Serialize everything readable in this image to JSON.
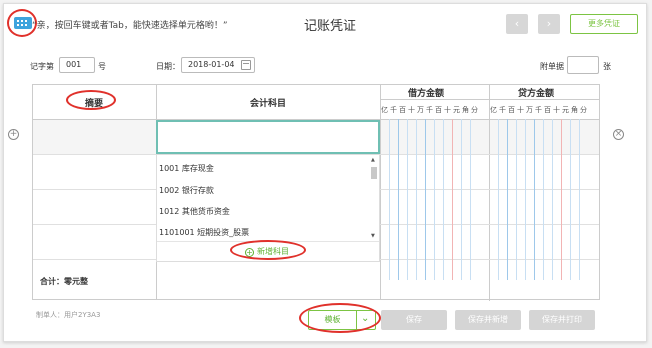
{
  "header": {
    "tip": "“亲，按回车键或者Tab，能快速选择单元格哟！”",
    "title": "记账凭证",
    "prev_glyph": "‹",
    "next_glyph": "›",
    "more_label": "更多凭证"
  },
  "meta": {
    "voucher_word_label": "记字第",
    "voucher_no": "001",
    "voucher_suffix": "号",
    "date_label": "日期：",
    "date": "2018-01-04",
    "attach_label": "附单据",
    "attach_value": "",
    "attach_unit": "张"
  },
  "table": {
    "col_summary": "摘要",
    "col_account": "会计科目",
    "col_debit": "借方金额",
    "col_credit": "贷方金额",
    "digits": [
      "亿",
      "千",
      "百",
      "十",
      "万",
      "千",
      "百",
      "十",
      "元",
      "角",
      "分"
    ],
    "total_label": "合计：",
    "total_value": "零元整"
  },
  "dropdown": {
    "items": [
      "1001 库存现金",
      "1002 银行存款",
      "1012 其他货币资金",
      "1101001 短期投资_股票"
    ],
    "add_label": "新增科目"
  },
  "footer": {
    "maker_label": "制单人：",
    "maker": "用户2Y3A3",
    "template_label": "模板",
    "save_label": "保存",
    "save_new_label": "保存并新增",
    "save_print_label": "保存并打印"
  },
  "icons": {
    "keyboard": "keyboard-icon",
    "calendar": "calendar-icon",
    "add_row": "plus-circle-icon",
    "delete_row": "close-circle-icon",
    "template_toggle": "chevron-down-icon"
  },
  "colors": {
    "accent_green": "#7cc443",
    "keyboard_blue": "#3ea4dd",
    "input_focus": "#6fbfb3",
    "annotation_red": "#e0312b",
    "disabled_gray": "#d5d5d5"
  }
}
